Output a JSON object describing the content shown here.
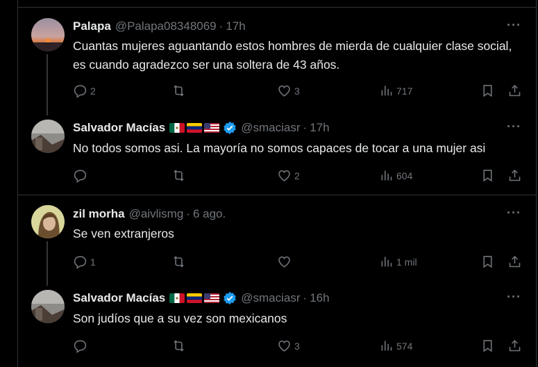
{
  "tweets": [
    {
      "name": "Palapa",
      "handle": "@Palapa08348069",
      "time": "17h",
      "text": "Cuantas mujeres aguantando estos hombres de mierda de cualquier clase social, es cuando agradezco ser una soltera de 43 años.",
      "replies": "2",
      "retweets": "",
      "likes": "3",
      "views": "717"
    },
    {
      "name": "Salvador Macías",
      "handle": "@smaciasr",
      "time": "17h",
      "text": "No todos somos asi. La mayoría no somos capaces de tocar a una mujer asi",
      "replies": "",
      "retweets": "",
      "likes": "2",
      "views": "604"
    },
    {
      "name": "zil morha",
      "handle": "@aivlismg",
      "time": "6 ago.",
      "text": "Se ven extranjeros",
      "replies": "1",
      "retweets": "",
      "likes": "",
      "views": "1 mil"
    },
    {
      "name": "Salvador Macías",
      "handle": "@smaciasr",
      "time": "16h",
      "text": "Son judíos que a su vez son mexicanos",
      "replies": "",
      "retweets": "",
      "likes": "3",
      "views": "574"
    }
  ],
  "more_label": "···",
  "dot": "·",
  "colors": {
    "background": "#000000",
    "text": "#e7e9ea",
    "muted": "#71767b",
    "verified": "#1d9bf0"
  }
}
